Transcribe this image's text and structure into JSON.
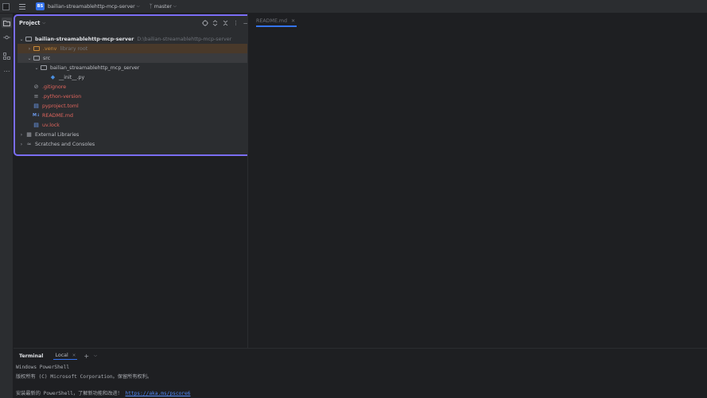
{
  "topbar": {
    "project_badge": "BS",
    "project_name": "bailian-streamablehttp-mcp-server",
    "branch_name": "master"
  },
  "stripe": {
    "icons": [
      "folder-icon",
      "commit-icon",
      "structure-icon",
      "more-icon"
    ]
  },
  "project_panel": {
    "title": "Project",
    "tools": [
      "locate-icon",
      "expand-all-icon",
      "collapse-all-icon",
      "options-icon",
      "minimize-icon"
    ],
    "tree": {
      "root_label": "bailian-streamablehttp-mcp-server",
      "root_path": "D:\\bailian-streamablehttp-mcp-server",
      "venv_label": ".venv",
      "venv_note": "library root",
      "src_label": "src",
      "package_label": "bailian_streamablehttp_mcp_server",
      "init_label": "__init__.py",
      "gitignore_label": ".gitignore",
      "python_version_label": ".python-version",
      "pyproject_label": "pyproject.toml",
      "readme_label": "README.md",
      "uvlock_label": "uv.lock",
      "external_label": "External Libraries",
      "scratches_label": "Scratches and Consoles"
    }
  },
  "editor": {
    "tab_label": "README.md"
  },
  "terminal": {
    "title": "Terminal",
    "tab_label": "Local",
    "line1": "Windows PowerShell",
    "line2": "版权所有 (C) Microsoft Corporation。保留所有权利。",
    "line3_prefix": "安装最新的 PowerShell，了解新功能和改进！",
    "line3_link": "https://aka.ms/pscore6"
  },
  "colors": {
    "accent_outline": "#7b6ef6",
    "excluded_folder": "#c88a3a",
    "untracked_file": "#e0655d",
    "link": "#548af7"
  }
}
